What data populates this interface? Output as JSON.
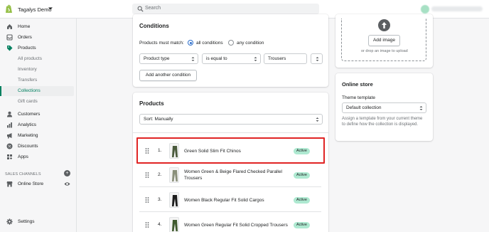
{
  "topbar": {
    "store_name": "Tagalys Demo",
    "search_placeholder": "Search"
  },
  "sidebar": {
    "items": [
      {
        "label": "Home",
        "icon": "home-icon"
      },
      {
        "label": "Orders",
        "icon": "orders-icon"
      },
      {
        "label": "Products",
        "icon": "tag-icon"
      },
      {
        "label": "All products"
      },
      {
        "label": "Inventory"
      },
      {
        "label": "Transfers"
      },
      {
        "label": "Collections"
      },
      {
        "label": "Gift cards"
      },
      {
        "label": "Customers",
        "icon": "person-icon"
      },
      {
        "label": "Analytics",
        "icon": "bar-chart-icon"
      },
      {
        "label": "Marketing",
        "icon": "megaphone-icon"
      },
      {
        "label": "Discounts",
        "icon": "discount-icon"
      },
      {
        "label": "Apps",
        "icon": "apps-icon"
      }
    ],
    "sales_channels_title": "SALES CHANNELS",
    "online_store_label": "Online Store",
    "settings_label": "Settings"
  },
  "conditions": {
    "title": "Conditions",
    "match_label": "Products must match:",
    "option_all": "all conditions",
    "option_any": "any condition",
    "field_value": "Product type",
    "operator_value": "is equal to",
    "input_value": "Trousers",
    "add_button": "Add another condition"
  },
  "products": {
    "title": "Products",
    "sort_prefix": "Sort:",
    "sort_value": "Manually",
    "rows": [
      {
        "num": "1.",
        "name": "Green Solid Slim Fit Chinos",
        "status": "Active"
      },
      {
        "num": "2.",
        "name": "Women Green & Beige Flared Checked Parallel Trousers",
        "status": "Active"
      },
      {
        "num": "3.",
        "name": "Women Black Regular Fit Solid Cargos",
        "status": "Active"
      },
      {
        "num": "4.",
        "name": "Women Green Regular Fit Solid Cropped Trousers",
        "status": "Active"
      }
    ]
  },
  "image": {
    "add_button": "Add image",
    "drop_hint": "or drop an image to upload"
  },
  "online_store": {
    "title": "Online store",
    "template_label": "Theme template",
    "template_value": "Default collection",
    "help_text": "Assign a template from your current theme to define how the collection is displayed."
  },
  "colors": {
    "accent": "#008060",
    "badge": "#aee9d1",
    "highlight": "#e02424"
  }
}
